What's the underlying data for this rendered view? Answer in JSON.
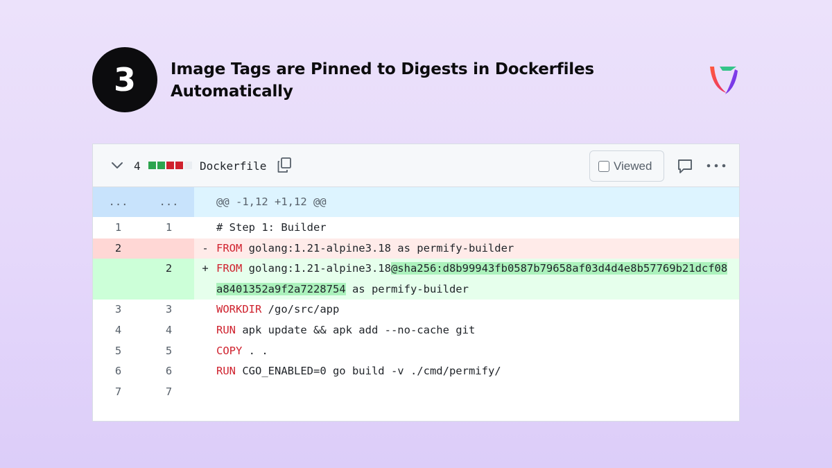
{
  "slide": {
    "step_number": "3",
    "title_line1": "Image Tags are Pinned to Digests in Dockerfiles",
    "title_line2": "Automatically"
  },
  "diff_header": {
    "change_count": "4",
    "blocks": [
      "#2da44e",
      "#2da44e",
      "#cf222e",
      "#cf222e",
      "#eaeef2"
    ],
    "filename": "Dockerfile",
    "viewed_label": "Viewed"
  },
  "diff": {
    "hunk": {
      "old": "...",
      "new": "...",
      "text": "@@ -1,12 +1,12 @@"
    },
    "lines": [
      {
        "type": "normal",
        "old": "1",
        "new": "1",
        "sign": "",
        "kw": "",
        "text": "# Step 1: Builder"
      },
      {
        "type": "del",
        "old": "2",
        "new": "",
        "sign": "-",
        "kw": "FROM",
        "text": " golang:1.21-alpine3.18 as permify-builder"
      },
      {
        "type": "add",
        "old": "",
        "new": "2",
        "sign": "+",
        "kw": "FROM",
        "text": " golang:1.21-alpine3.18",
        "highlight": "@sha256:d8b99943fb0587b79658af03d4d4e8b57769b21dcf08a8401352a9f2a7228754",
        "tail": " as permify-builder"
      },
      {
        "type": "normal",
        "old": "3",
        "new": "3",
        "sign": "",
        "kw": "WORKDIR",
        "text": " /go/src/app"
      },
      {
        "type": "normal",
        "old": "4",
        "new": "4",
        "sign": "",
        "kw": "RUN",
        "text": " apk update && apk add --no-cache git"
      },
      {
        "type": "normal",
        "old": "5",
        "new": "5",
        "sign": "",
        "kw": "COPY",
        "text": " . ."
      },
      {
        "type": "normal",
        "old": "6",
        "new": "6",
        "sign": "",
        "kw": "RUN",
        "text": " CGO_ENABLED=0 go build -v ./cmd/permify/"
      },
      {
        "type": "normal",
        "old": "7",
        "new": "7",
        "sign": "",
        "kw": "",
        "text": ""
      }
    ]
  },
  "colors": {
    "accent_red": "#cf222e",
    "add_bg": "#e6ffec",
    "del_bg": "#ffebe9",
    "hunk_bg": "#ddf4ff"
  },
  "icons": [
    "chevron-down-icon",
    "copy-icon",
    "comment-icon",
    "kebab-menu-icon",
    "brand-logo-icon"
  ]
}
